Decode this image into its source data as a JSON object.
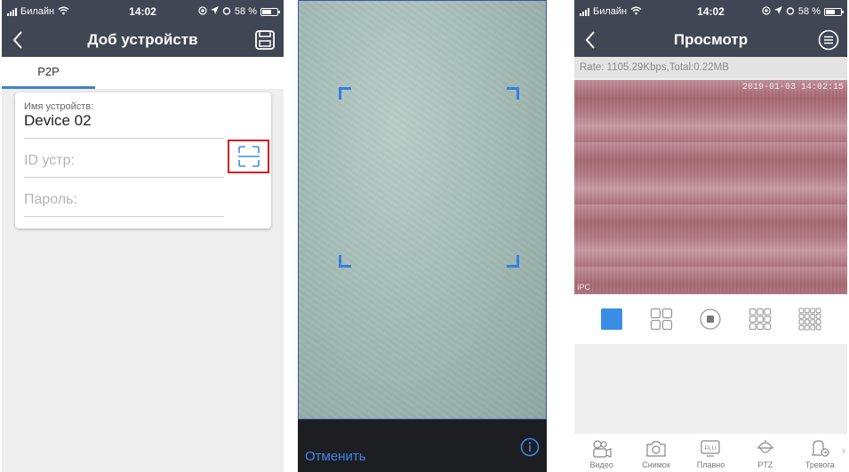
{
  "status": {
    "carrier": "Билайн",
    "time": "14:02",
    "battery": "58 %",
    "battery_level": 0.58
  },
  "add_device": {
    "title": "Доб устройств",
    "tab": "P2P",
    "name_label": "Имя устройств:",
    "name_value": "Device 02",
    "id_placeholder": "ID устр:",
    "password_placeholder": "Пароль:"
  },
  "scanner": {
    "cancel_label": "Отменить"
  },
  "preview": {
    "title": "Просмотр",
    "rate": "Rate: 1105.29Kbps,Total:0.22MB",
    "osd_time": "2019-01-03 14:02:15",
    "osd_label": "IPC",
    "toolbar": [
      {
        "icon": "video-camera-icon",
        "label": "Видео"
      },
      {
        "icon": "camera-icon",
        "label": "Снимок"
      },
      {
        "icon": "fluency-icon",
        "label": "Плавно"
      },
      {
        "icon": "ptz-icon",
        "label": "PTZ"
      },
      {
        "icon": "alarm-icon",
        "label": "Тревога"
      }
    ],
    "layouts": [
      "single-view-icon",
      "quad-view-icon",
      "record-icon",
      "nine-view-icon",
      "sixteen-view-icon"
    ],
    "accent": "#3a8ee6"
  }
}
